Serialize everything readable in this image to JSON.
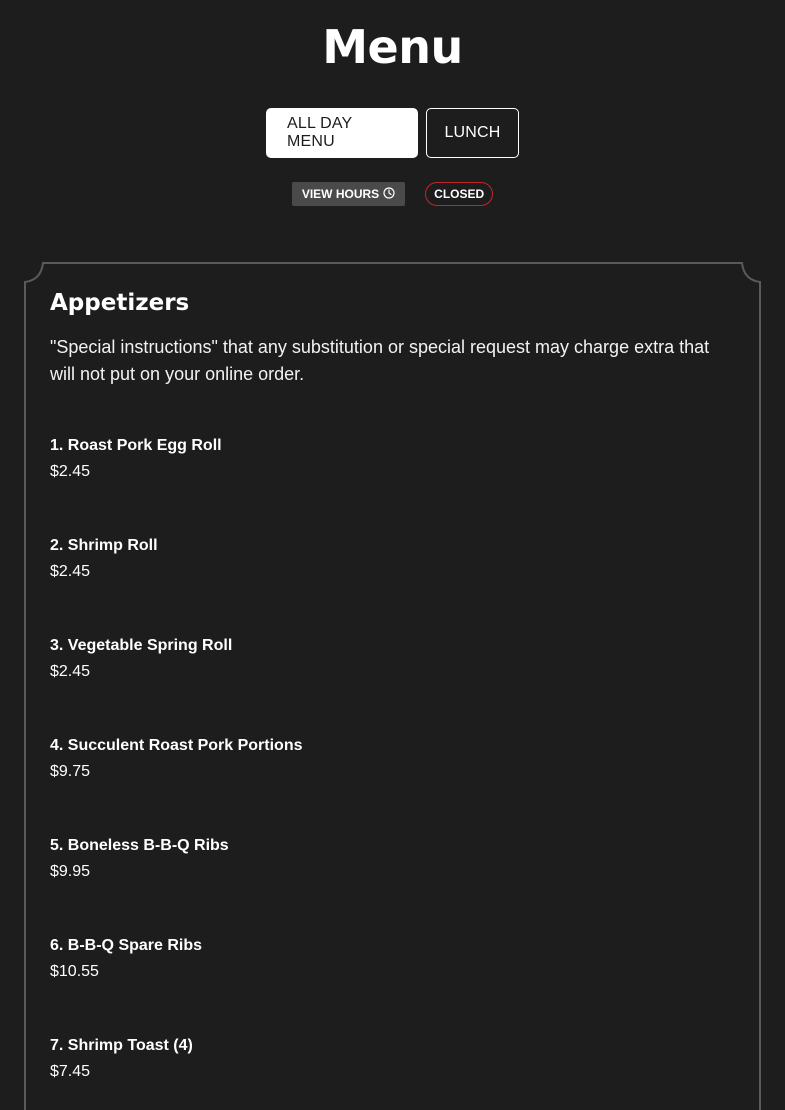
{
  "page": {
    "title": "Menu"
  },
  "tabs": [
    {
      "label": "ALL DAY MENU",
      "active": true
    },
    {
      "label": "LUNCH",
      "active": false
    }
  ],
  "status": {
    "view_hours_label": "VIEW HOURS",
    "view_hours_icon": "clock-icon",
    "closed_label": "CLOSED",
    "closed_color": "#c0272d"
  },
  "section": {
    "title": "Appetizers",
    "description": "\"Special instructions\" that any substitution or special request may charge extra that will not put on your online order.",
    "items": [
      {
        "name": "1. Roast Pork Egg Roll",
        "price": "$2.45"
      },
      {
        "name": "2. Shrimp Roll",
        "price": "$2.45"
      },
      {
        "name": "3. Vegetable Spring Roll",
        "price": "$2.45"
      },
      {
        "name": "4. Succulent Roast Pork Portions",
        "price": "$9.75"
      },
      {
        "name": "5. Boneless B-B-Q Ribs",
        "price": "$9.95"
      },
      {
        "name": "6. B-B-Q Spare Ribs",
        "price": "$10.55"
      },
      {
        "name": "7. Shrimp Toast (4)",
        "price": "$7.45"
      }
    ]
  },
  "colors": {
    "background": "#1d1d1d",
    "text": "#ffffff",
    "card_border": "#5a5a5a"
  }
}
